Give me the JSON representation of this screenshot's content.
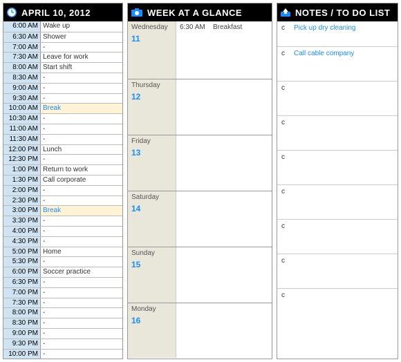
{
  "schedule": {
    "title": "APRIL 10, 2012",
    "rows": [
      {
        "time": "6:00 AM",
        "event": "Wake up"
      },
      {
        "time": "6:30 AM",
        "event": "Shower"
      },
      {
        "time": "7:00 AM",
        "event": "-"
      },
      {
        "time": "7:30 AM",
        "event": "Leave for work"
      },
      {
        "time": "8:00 AM",
        "event": "Start shift"
      },
      {
        "time": "8:30 AM",
        "event": "-"
      },
      {
        "time": "9:00 AM",
        "event": "-"
      },
      {
        "time": "9:30 AM",
        "event": "-"
      },
      {
        "time": "10:00 AM",
        "event": "Break",
        "break": true
      },
      {
        "time": "10:30 AM",
        "event": "-"
      },
      {
        "time": "11:00 AM",
        "event": "-"
      },
      {
        "time": "11:30 AM",
        "event": "-"
      },
      {
        "time": "12:00 PM",
        "event": "Lunch"
      },
      {
        "time": "12:30 PM",
        "event": "-"
      },
      {
        "time": "1:00 PM",
        "event": "Return to work"
      },
      {
        "time": "1:30 PM",
        "event": "Call corporate"
      },
      {
        "time": "2:00 PM",
        "event": "-"
      },
      {
        "time": "2:30 PM",
        "event": "-"
      },
      {
        "time": "3:00 PM",
        "event": "Break",
        "break": true
      },
      {
        "time": "3:30 PM",
        "event": "-"
      },
      {
        "time": "4:00 PM",
        "event": "-"
      },
      {
        "time": "4:30 PM",
        "event": "-"
      },
      {
        "time": "5:00 PM",
        "event": "Home"
      },
      {
        "time": "5:30 PM",
        "event": "-"
      },
      {
        "time": "6:00 PM",
        "event": "Soccer practice"
      },
      {
        "time": "6:30 PM",
        "event": "-"
      },
      {
        "time": "7:00 PM",
        "event": "-"
      },
      {
        "time": "7:30 PM",
        "event": "-"
      },
      {
        "time": "8:00 PM",
        "event": "-"
      },
      {
        "time": "8:30 PM",
        "event": "-"
      },
      {
        "time": "9:00 PM",
        "event": "-"
      },
      {
        "time": "9:30 PM",
        "event": "-"
      },
      {
        "time": "10:00 PM",
        "event": "-"
      }
    ]
  },
  "week": {
    "title": "WEEK AT A GLANCE",
    "days": [
      {
        "name": "Wednesday",
        "num": "11",
        "events": [
          {
            "time": "6:30 AM",
            "text": "Breakfast"
          }
        ]
      },
      {
        "name": "Thursday",
        "num": "12",
        "events": []
      },
      {
        "name": "Friday",
        "num": "13",
        "events": []
      },
      {
        "name": "Saturday",
        "num": "14",
        "events": []
      },
      {
        "name": "Sunday",
        "num": "15",
        "events": []
      },
      {
        "name": "Monday",
        "num": "16",
        "events": []
      }
    ]
  },
  "notes": {
    "title": "NOTES / TO DO LIST",
    "items": [
      {
        "check": "c",
        "text": "Pick up dry cleaning"
      },
      {
        "check": "c",
        "text": "Call cable company"
      },
      {
        "check": "c",
        "text": ""
      },
      {
        "check": "c",
        "text": ""
      },
      {
        "check": "c",
        "text": ""
      },
      {
        "check": "c",
        "text": ""
      },
      {
        "check": "c",
        "text": ""
      },
      {
        "check": "c",
        "text": ""
      },
      {
        "check": "c",
        "text": ""
      }
    ]
  }
}
